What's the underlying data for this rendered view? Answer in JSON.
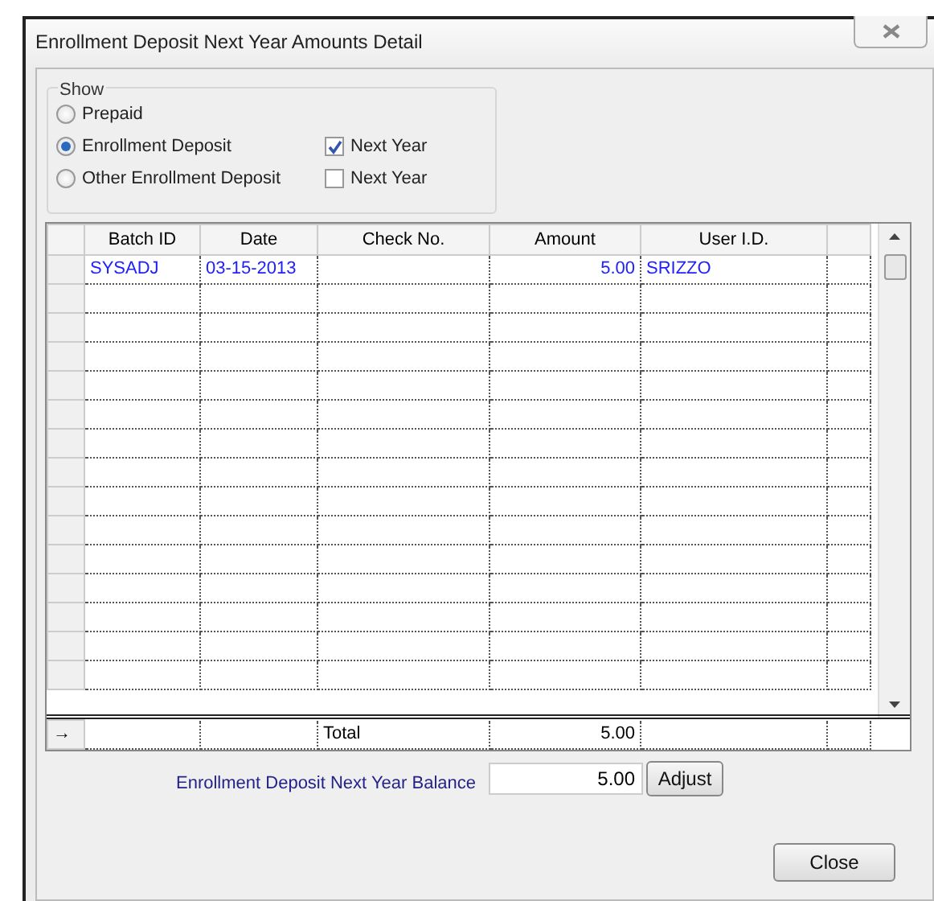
{
  "window": {
    "title": "Enrollment Deposit Next Year Amounts Detail"
  },
  "show": {
    "label": "Show",
    "options": [
      {
        "label": "Prepaid",
        "selected": false
      },
      {
        "label": "Enrollment Deposit",
        "selected": true,
        "next_year": {
          "label": "Next Year",
          "checked": true
        }
      },
      {
        "label": "Other Enrollment Deposit",
        "selected": false,
        "next_year": {
          "label": "Next Year",
          "checked": false
        }
      }
    ]
  },
  "table": {
    "columns": [
      "Batch ID",
      "Date",
      "Check No.",
      "Amount",
      "User I.D."
    ],
    "rows": [
      {
        "cells": [
          "SYSADJ",
          "03-15-2013",
          "",
          "5.00",
          "SRIZZO"
        ]
      }
    ],
    "total_row": {
      "marker": "→",
      "label": "Total",
      "amount": "5.00"
    }
  },
  "balance": {
    "label": "Enrollment Deposit Next Year Balance",
    "value": "5.00",
    "button": "Adjust"
  },
  "buttons": [
    "Close"
  ]
}
